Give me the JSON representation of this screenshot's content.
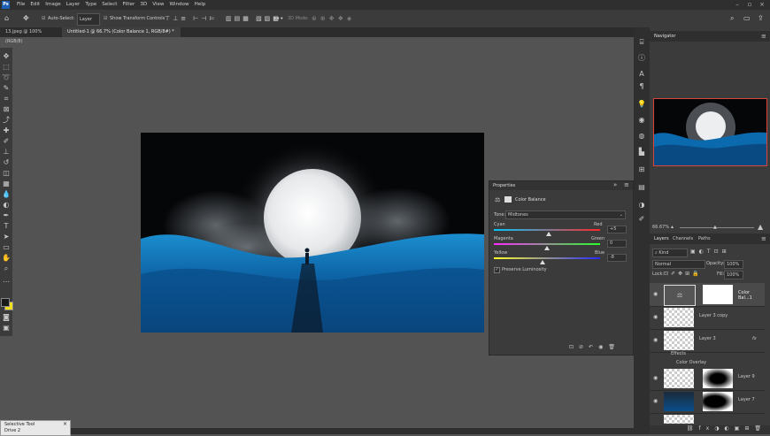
{
  "menubar": {
    "logo": "Ps",
    "items": [
      "File",
      "Edit",
      "Image",
      "Layer",
      "Type",
      "Select",
      "Filter",
      "3D",
      "View",
      "Window",
      "Help"
    ]
  },
  "options": {
    "auto_select_label": "Auto-Select:",
    "auto_select_value": "Layer",
    "show_transform_label": "Show Transform Controls",
    "mode_3d_label": "3D Mode:"
  },
  "tabs": [
    {
      "label": "13.jpeg @ 100% (RGB/8)"
    },
    {
      "label": "Untitled-1 @ 66.7% (Color Balance 1, RGB/8#) *"
    }
  ],
  "properties": {
    "title": "Properties",
    "adjustment_name": "Color Balance",
    "tone_label": "Tone:",
    "tone_value": "Midtones",
    "sliders": [
      {
        "left": "Cyan",
        "right": "Red",
        "value": "+5",
        "position": 0.52
      },
      {
        "left": "Magenta",
        "right": "Green",
        "value": "0",
        "position": 0.5
      },
      {
        "left": "Yellow",
        "right": "Blue",
        "value": "-8",
        "position": 0.46
      }
    ],
    "preserve_luminosity": "Preserve Luminosity",
    "preserve_checked": true
  },
  "navigator": {
    "title": "Navigator",
    "zoom": "66.67%"
  },
  "layers_panel": {
    "tabs": [
      "Layers",
      "Channels",
      "Paths"
    ],
    "kind_label": "Kind",
    "blend_mode": "Normal",
    "opacity_label": "Opacity:",
    "opacity_value": "100%",
    "lock_label": "Lock:",
    "fill_label": "Fill:",
    "fill_value": "100%",
    "layers": [
      {
        "name": "Color Bal...1"
      },
      {
        "name": "Layer 3 copy"
      },
      {
        "name": "Layer 3",
        "fx": "fx"
      },
      {
        "name": "Layer 9"
      },
      {
        "name": "Layer 7"
      }
    ],
    "effects_label": "Effects",
    "color_overlay_label": "Color Overlay"
  },
  "tooltip": {
    "line1": "Selective Tool",
    "line2": "Drive 2"
  },
  "colors": {
    "accent": "#1d5fb4",
    "panel": "#3b3b3b",
    "navigator_border": "#d8453a",
    "foreground": "#f0e020",
    "background": "#1a1a1a"
  }
}
